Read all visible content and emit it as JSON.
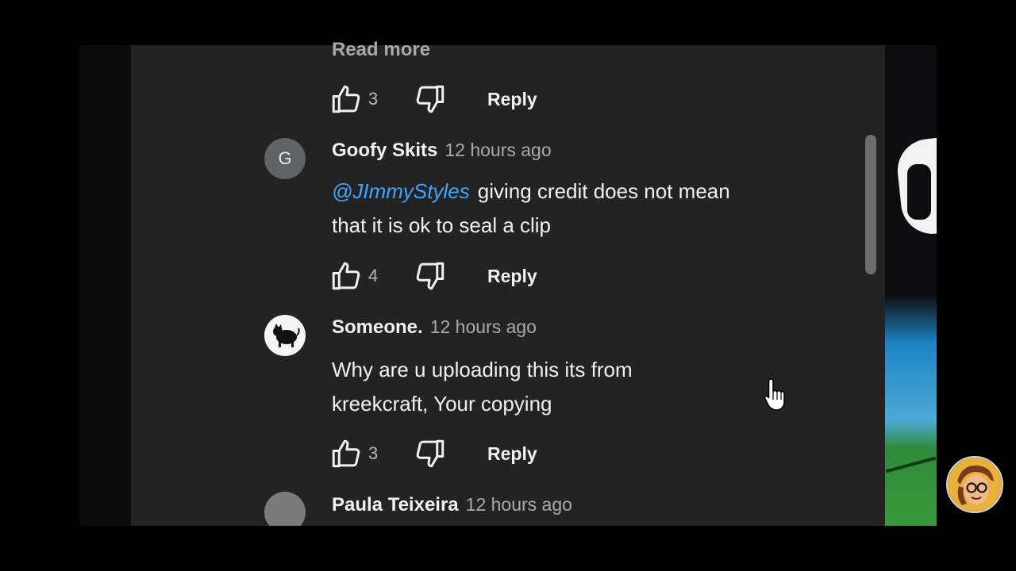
{
  "thread": {
    "read_more": "Read more",
    "top_actions": {
      "likes": "3",
      "reply_label": "Reply"
    }
  },
  "comments": [
    {
      "avatar_letter": "G",
      "author": "Goofy Skits",
      "time": "12 hours ago",
      "mention": "@JImmyStyles",
      "text": "giving credit does not mean that it is ok to seal a clip",
      "likes": "4",
      "reply_label": "Reply"
    },
    {
      "author": "Someone.",
      "time": "12 hours ago",
      "text": "Why are u uploading this its from kreekcraft, Your copying",
      "likes": "3",
      "reply_label": "Reply"
    },
    {
      "author": "Paula Teixeira",
      "time": "12 hours ago"
    }
  ],
  "icons": {
    "like": "thumbs-up-icon",
    "dislike": "thumbs-down-icon",
    "cursor": "hand-pointer-icon"
  },
  "colors": {
    "panel_bg": "#232323",
    "mention": "#3ea6ff",
    "secondary_text": "#aaaaaa"
  }
}
